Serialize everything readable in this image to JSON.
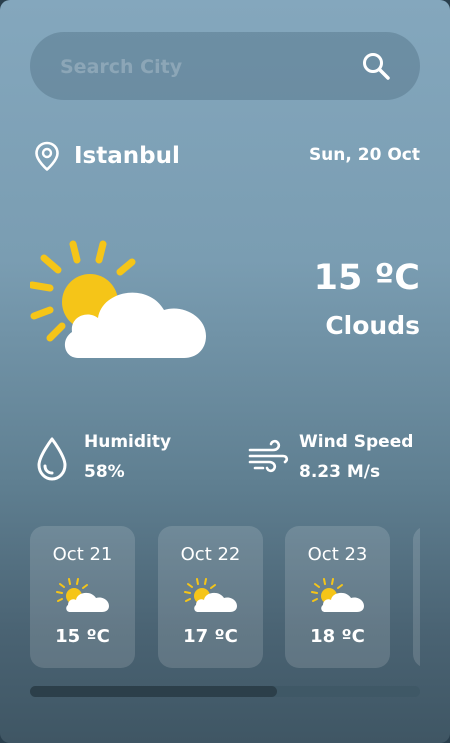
{
  "search": {
    "placeholder": "Search City",
    "value": ""
  },
  "location": {
    "city": "Istanbul",
    "date": "Sun, 20 Oct"
  },
  "current": {
    "temperature": "15 ºC",
    "condition": "Clouds",
    "icon": "sun-cloud-icon"
  },
  "stats": {
    "humidity": {
      "label": "Humidity",
      "value": "58%",
      "icon": "droplet-icon"
    },
    "wind": {
      "label": "Wind Speed",
      "value": "8.23 M/s",
      "icon": "wind-icon"
    }
  },
  "forecast": [
    {
      "date": "Oct 21",
      "temp": "15 ºC",
      "icon": "sun-cloud-icon"
    },
    {
      "date": "Oct 22",
      "temp": "17 ºC",
      "icon": "sun-cloud-icon"
    },
    {
      "date": "Oct 23",
      "temp": "18 ºC",
      "icon": "sun-cloud-icon"
    }
  ],
  "colors": {
    "sun": "#f5c518",
    "cloud": "#ffffff"
  }
}
